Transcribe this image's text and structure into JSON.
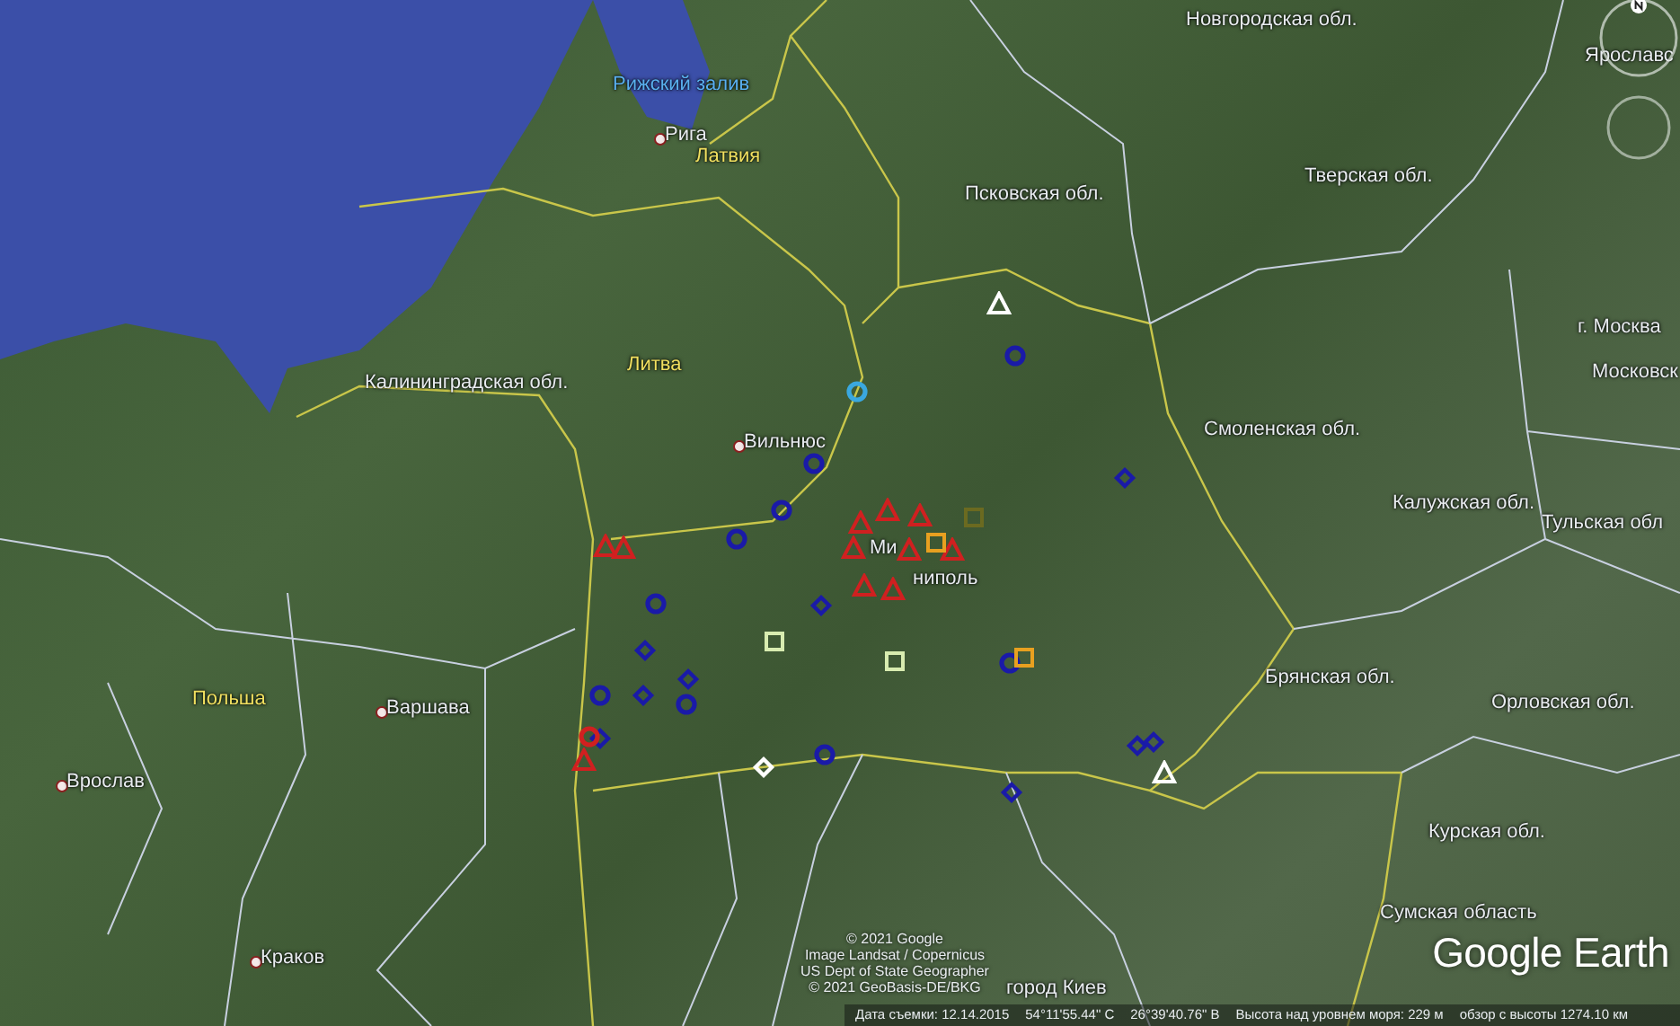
{
  "map": {
    "labels": [
      {
        "text": "Новгородская обл.",
        "kind": "region"
      },
      {
        "text": "Ярославс",
        "kind": "region"
      },
      {
        "text": "Рижский залив",
        "kind": "water"
      },
      {
        "text": "Рига",
        "kind": "city"
      },
      {
        "text": "Латвия",
        "kind": "country"
      },
      {
        "text": "Тверская обл.",
        "kind": "region"
      },
      {
        "text": "Псковская обл.",
        "kind": "region"
      },
      {
        "text": "г. Москва",
        "kind": "region"
      },
      {
        "text": "Московск",
        "kind": "region"
      },
      {
        "text": "Калининградская обл.",
        "kind": "region"
      },
      {
        "text": "Литва",
        "kind": "country"
      },
      {
        "text": "Смоленская обл.",
        "kind": "region"
      },
      {
        "text": "Вильнюс",
        "kind": "city"
      },
      {
        "text": "Калужская обл.",
        "kind": "region"
      },
      {
        "text": "Тульская обл",
        "kind": "region"
      },
      {
        "text": "Ми",
        "kind": "region"
      },
      {
        "text": "ниполь",
        "kind": "region"
      },
      {
        "text": "Брянская обл.",
        "kind": "region"
      },
      {
        "text": "Польша",
        "kind": "country"
      },
      {
        "text": "Варшава",
        "kind": "city"
      },
      {
        "text": "Орловская обл.",
        "kind": "region"
      },
      {
        "text": "Вроcлав",
        "kind": "city"
      },
      {
        "text": "Курская обл.",
        "kind": "region"
      },
      {
        "text": "Сумская область",
        "kind": "region"
      },
      {
        "text": "Краков",
        "kind": "city"
      },
      {
        "text": "город Киев",
        "kind": "region"
      }
    ],
    "markers": [
      {
        "kind": "circle",
        "color": "#1a1aa8"
      },
      {
        "kind": "circle",
        "color": "#1a1aa8"
      },
      {
        "kind": "circle",
        "color": "#1a1aa8"
      },
      {
        "kind": "circle",
        "color": "#1a1aa8"
      },
      {
        "kind": "circle",
        "color": "#1a1aa8"
      },
      {
        "kind": "circle",
        "color": "#1a1aa8"
      },
      {
        "kind": "circle",
        "color": "#1a1aa8"
      },
      {
        "kind": "circle",
        "color": "#1a1aa8"
      },
      {
        "kind": "circle",
        "color": "#1a1aa8"
      },
      {
        "kind": "diamond",
        "color": "#1a1aa8"
      },
      {
        "kind": "diamond",
        "color": "#1a1aa8"
      },
      {
        "kind": "diamond",
        "color": "#1a1aa8"
      },
      {
        "kind": "diamond",
        "color": "#1a1aa8"
      },
      {
        "kind": "diamond",
        "color": "#1a1aa8"
      },
      {
        "kind": "diamond",
        "color": "#1a1aa8"
      },
      {
        "kind": "diamond",
        "color": "#1a1aa8"
      },
      {
        "kind": "diamond",
        "color": "#1a1aa8"
      },
      {
        "kind": "diamond",
        "color": "#1a1aa8"
      },
      {
        "kind": "circle",
        "color": "#3aa8e0"
      },
      {
        "kind": "triangle",
        "color": "#ffffff"
      },
      {
        "kind": "triangle",
        "color": "#ffffff"
      },
      {
        "kind": "triangle",
        "color": "#d02020"
      },
      {
        "kind": "triangle",
        "color": "#d02020"
      },
      {
        "kind": "triangle",
        "color": "#d02020"
      },
      {
        "kind": "triangle",
        "color": "#d02020"
      },
      {
        "kind": "triangle",
        "color": "#d02020"
      },
      {
        "kind": "triangle",
        "color": "#d02020"
      },
      {
        "kind": "triangle",
        "color": "#d02020"
      },
      {
        "kind": "triangle",
        "color": "#d02020"
      },
      {
        "kind": "triangle",
        "color": "#d02020"
      },
      {
        "kind": "triangle",
        "color": "#d02020"
      },
      {
        "kind": "triangle",
        "color": "#d02020"
      },
      {
        "kind": "circle",
        "color": "#d02020"
      },
      {
        "kind": "square",
        "color": "#6b6a20"
      },
      {
        "kind": "square",
        "color": "#e8a020"
      },
      {
        "kind": "square",
        "color": "#e8a020"
      },
      {
        "kind": "square",
        "color": "#d8ecb0"
      },
      {
        "kind": "square",
        "color": "#d8ecb0"
      },
      {
        "kind": "diamond",
        "color": "#ffffff"
      }
    ],
    "attribution": [
      "© 2021 Google",
      "Image Landsat / Copernicus",
      "US Dept of State Geographer",
      "© 2021 GeoBasis-DE/BKG"
    ],
    "logo": "Google Earth"
  },
  "status_bar": {
    "date": "Дата съемки: 12.14.2015",
    "latitude": "54°11'55.44\" С",
    "longitude": "26°39'40.76\" В",
    "elevation": "Высота над уровнем моря:  229 м",
    "eye_altitude": "обзор с высоты 1274.10 км"
  }
}
